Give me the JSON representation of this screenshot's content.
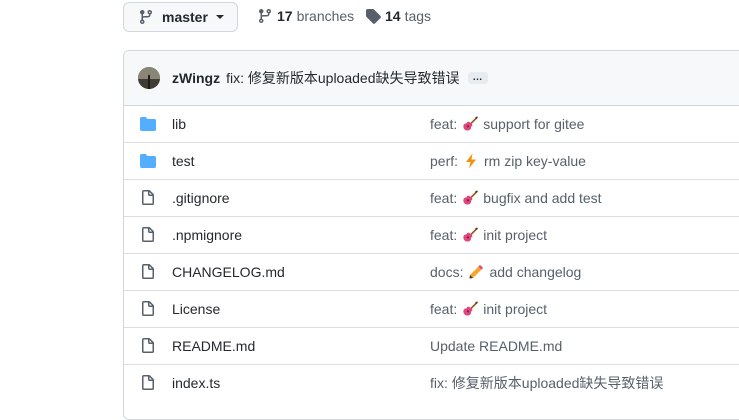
{
  "branch": {
    "name": "master"
  },
  "branches": {
    "count": "17",
    "label": "branches"
  },
  "tags": {
    "count": "14",
    "label": "tags"
  },
  "latest_commit": {
    "author": "zWingz",
    "message": "fix: 修复新版本uploaded缺失导致错误",
    "more": "…"
  },
  "files": [
    {
      "name": "lib",
      "type": "folder",
      "commit_prefix": "feat:",
      "commit_emoji": "guitar",
      "commit_text": "support for gitee"
    },
    {
      "name": "test",
      "type": "folder",
      "commit_prefix": "perf:",
      "commit_emoji": "zap",
      "commit_text": "rm zip key-value"
    },
    {
      "name": ".gitignore",
      "type": "file",
      "commit_prefix": "feat:",
      "commit_emoji": "guitar",
      "commit_text": "bugfix and add test"
    },
    {
      "name": ".npmignore",
      "type": "file",
      "commit_prefix": "feat:",
      "commit_emoji": "guitar",
      "commit_text": "init project"
    },
    {
      "name": "CHANGELOG.md",
      "type": "file",
      "commit_prefix": "docs:",
      "commit_emoji": "pencil",
      "commit_text": "add changelog"
    },
    {
      "name": "License",
      "type": "file",
      "commit_prefix": "feat:",
      "commit_emoji": "guitar",
      "commit_text": "init project"
    },
    {
      "name": "README.md",
      "type": "file",
      "commit_prefix": "",
      "commit_emoji": "",
      "commit_text": "Update README.md"
    },
    {
      "name": "index.ts",
      "type": "file",
      "commit_prefix": "",
      "commit_emoji": "",
      "commit_text": "fix: 修复新版本uploaded缺失导致错误"
    }
  ],
  "colors": {
    "folder": "#54aeff",
    "link_muted": "#57606a",
    "border": "#d0d7de"
  }
}
